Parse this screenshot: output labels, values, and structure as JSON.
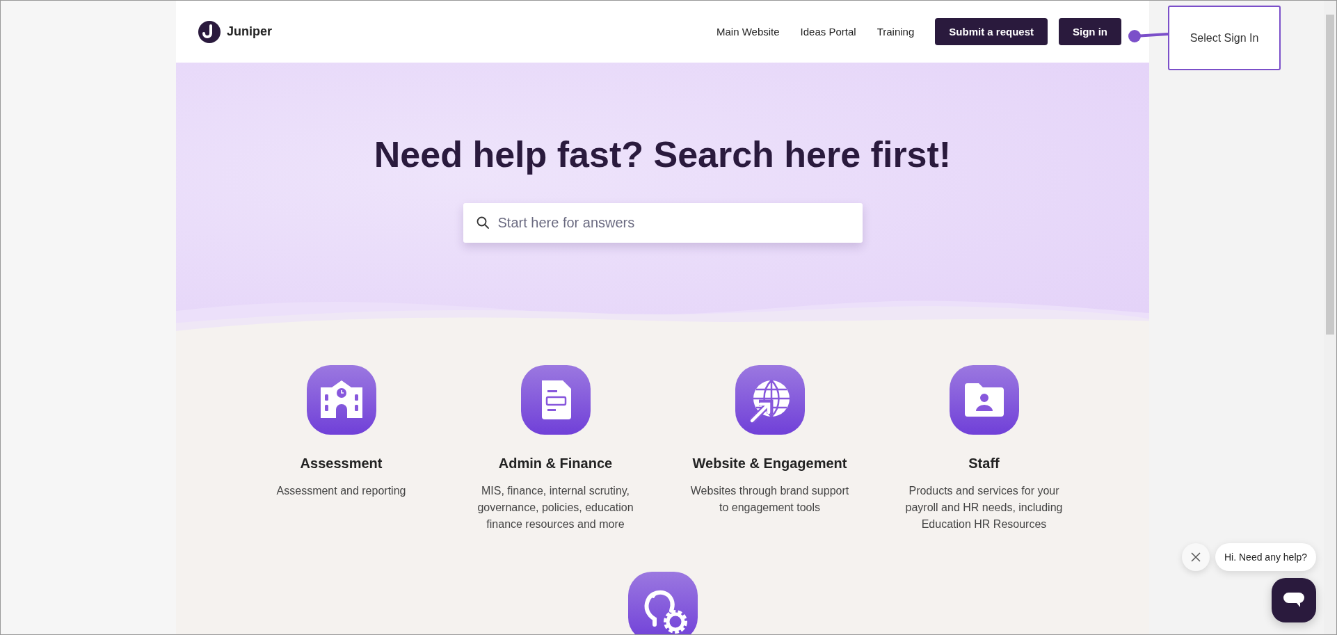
{
  "logo": {
    "name": "Juniper"
  },
  "nav": {
    "links": [
      "Main Website",
      "Ideas Portal",
      "Training"
    ],
    "buttons": [
      "Submit a request",
      "Sign in"
    ]
  },
  "callout": {
    "text": "Select Sign In"
  },
  "hero": {
    "title": "Need help fast? Search here first!",
    "search": {
      "placeholder": "Start here for answers"
    }
  },
  "categories": [
    {
      "kind": "school",
      "title": "Assessment",
      "description": "Assessment and reporting"
    },
    {
      "kind": "document",
      "title": "Admin & Finance",
      "description": "MIS, finance, internal scrutiny, governance, policies, education finance resources and more"
    },
    {
      "kind": "globe",
      "title": "Website & Engagement",
      "description": "Websites through brand support to engagement tools"
    },
    {
      "kind": "folder",
      "title": "Staff",
      "description": "Products and services for your payroll and HR needs, including Education HR Resources"
    },
    {
      "kind": "idea"
    }
  ],
  "chat": {
    "greeting": "Hi. Need any help?"
  }
}
